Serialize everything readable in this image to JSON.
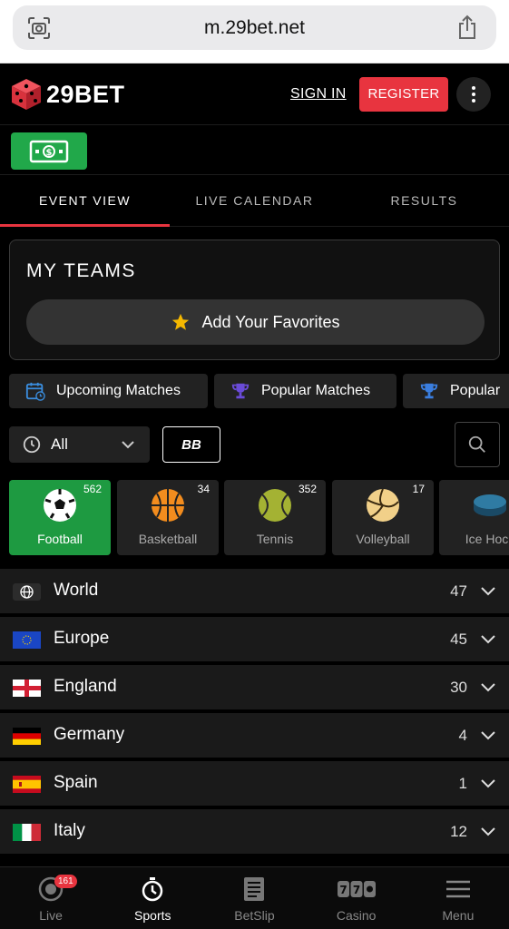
{
  "browser": {
    "url": "m.29bet.net"
  },
  "header": {
    "brand": "29BET",
    "sign_in": "SIGN IN",
    "register": "REGISTER"
  },
  "tabs": [
    {
      "label": "EVENT VIEW",
      "active": true
    },
    {
      "label": "LIVE CALENDAR",
      "active": false
    },
    {
      "label": "RESULTS",
      "active": false
    }
  ],
  "my_teams": {
    "title": "MY TEAMS",
    "add_favorites": "Add Your Favorites"
  },
  "chips": [
    {
      "label": "Upcoming Matches",
      "icon": "calendar-icon"
    },
    {
      "label": "Popular Matches",
      "icon": "trophy-icon"
    },
    {
      "label": "Popular",
      "icon": "trophy-icon"
    }
  ],
  "filter": {
    "time_value": "All",
    "bb_label": "BB"
  },
  "sports": [
    {
      "label": "Football",
      "count": "562",
      "active": true
    },
    {
      "label": "Basketball",
      "count": "34",
      "active": false
    },
    {
      "label": "Tennis",
      "count": "352",
      "active": false
    },
    {
      "label": "Volleyball",
      "count": "17",
      "active": false
    },
    {
      "label": "Ice Hock",
      "count": "",
      "active": false
    }
  ],
  "regions": [
    {
      "name": "World",
      "count": "47",
      "flag": "globe"
    },
    {
      "name": "Europe",
      "count": "45",
      "flag": "eu"
    },
    {
      "name": "England",
      "count": "30",
      "flag": "england"
    },
    {
      "name": "Germany",
      "count": "4",
      "flag": "germany"
    },
    {
      "name": "Spain",
      "count": "1",
      "flag": "spain"
    },
    {
      "name": "Italy",
      "count": "12",
      "flag": "italy"
    }
  ],
  "bottom_nav": [
    {
      "label": "Live",
      "badge": "161",
      "active": false
    },
    {
      "label": "Sports",
      "active": true
    },
    {
      "label": "BetSlip",
      "active": false
    },
    {
      "label": "Casino",
      "active": false
    },
    {
      "label": "Menu",
      "active": false
    }
  ],
  "colors": {
    "accent": "#e8343f",
    "green": "#1e9a41"
  }
}
